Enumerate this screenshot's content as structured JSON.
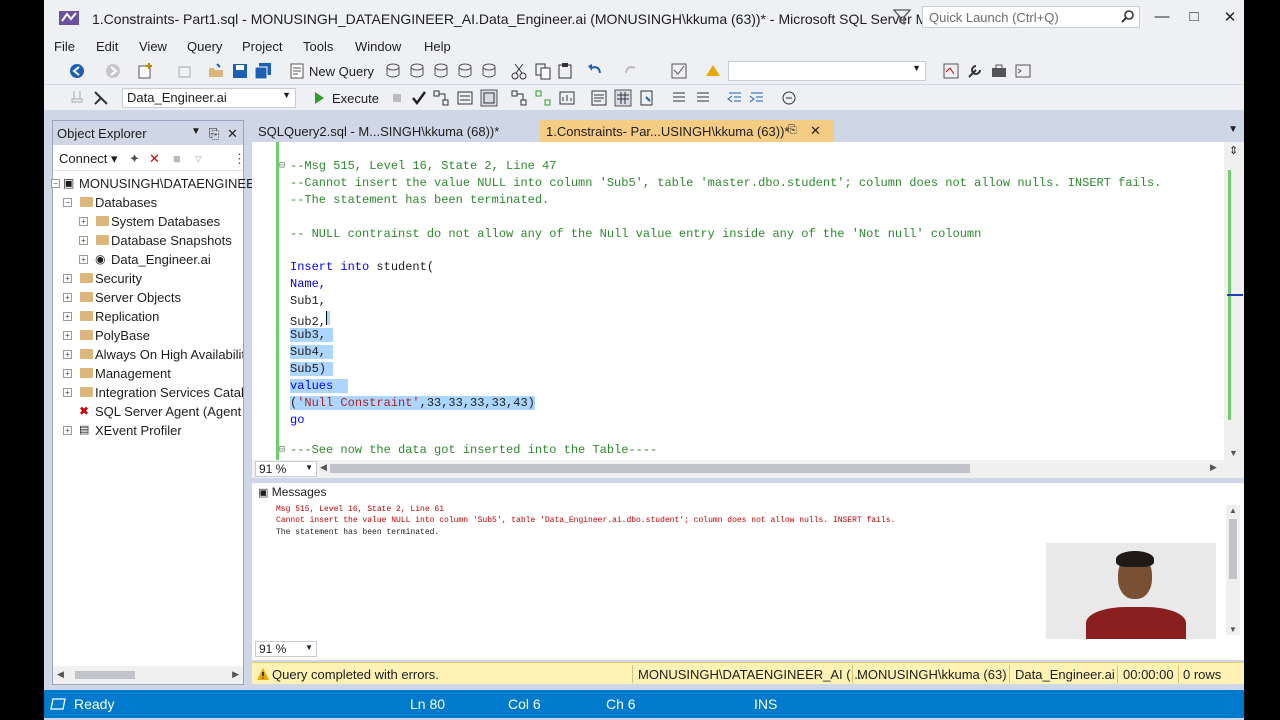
{
  "window": {
    "title": "1.Constraints- Part1.sql - MONUSINGH_DATAENGINEER_AI.Data_Engineer.ai (MONUSINGH\\kkuma (63))* - Microsoft SQL Server Manage...",
    "quick_launch_placeholder": "Quick Launch (Ctrl+Q)"
  },
  "menu": [
    "File",
    "Edit",
    "View",
    "Query",
    "Project",
    "Tools",
    "Window",
    "Help"
  ],
  "toolbar": {
    "new_query": "New Query",
    "database": "Data_Engineer.ai",
    "execute": "Execute"
  },
  "object_explorer": {
    "title": "Object Explorer",
    "connect": "Connect",
    "nodes": [
      "MONUSINGH\\DATAENGINEER_AI",
      "Databases",
      "System Databases",
      "Database Snapshots",
      "Data_Engineer.ai",
      "Security",
      "Server Objects",
      "Replication",
      "PolyBase",
      "Always On High Availability",
      "Management",
      "Integration Services Catalogs",
      "SQL Server Agent (Agent XPs disabled)",
      "XEvent Profiler"
    ]
  },
  "tabs": {
    "inactive": "SQLQuery2.sql - M...SINGH\\kkuma (68))*",
    "active": "1.Constraints- Par...USINGH\\kkuma (63))*"
  },
  "code": {
    "l1": "--Msg 515, Level 16, State 2, Line 47",
    "l2": "--Cannot insert the value NULL into column 'Sub5', table 'master.dbo.student'; column does not allow nulls. INSERT fails.",
    "l3": "--The statement has been terminated.",
    "l4": "-- NULL contrainst do not allow any of the Null value entry inside any of the 'Not null' coloumn",
    "l5_kw": "Insert into",
    "l5_id": " student(",
    "l6": "Name,",
    "l7": "Sub1,",
    "l8": "Sub2,",
    "l9": "Sub3,",
    "l10": "Sub4,",
    "l11": "Sub5)",
    "l12": "values",
    "l13_open": "(",
    "l13_str": "'Null Constraint'",
    "l13_rest": ",33,33,33,33,43)",
    "l14": "go",
    "l15": "---See now the data got inserted into the Table----"
  },
  "zoom": "91 %",
  "messages": {
    "tab": "Messages",
    "line1": "Msg 515, Level 16, State 2, Line 61",
    "line2": "Cannot insert the value NULL into column 'Sub5', table 'Data_Engineer.ai.dbo.student'; column does not allow nulls. INSERT fails.",
    "line3": "The statement has been terminated."
  },
  "query_status": {
    "text": "Query completed with errors.",
    "server": "MONUSINGH\\DATAENGINEER_AI (...",
    "user": "MONUSINGH\\kkuma (63)",
    "db": "Data_Engineer.ai",
    "time": "00:00:00",
    "rows": "0 rows"
  },
  "status": {
    "ready": "Ready",
    "ln": "Ln 80",
    "col": "Col 6",
    "ch": "Ch 6",
    "ins": "INS"
  },
  "colors": {
    "accent": "#007acc",
    "active_tab": "#f5cc84",
    "error_bar": "#fff2b5"
  }
}
